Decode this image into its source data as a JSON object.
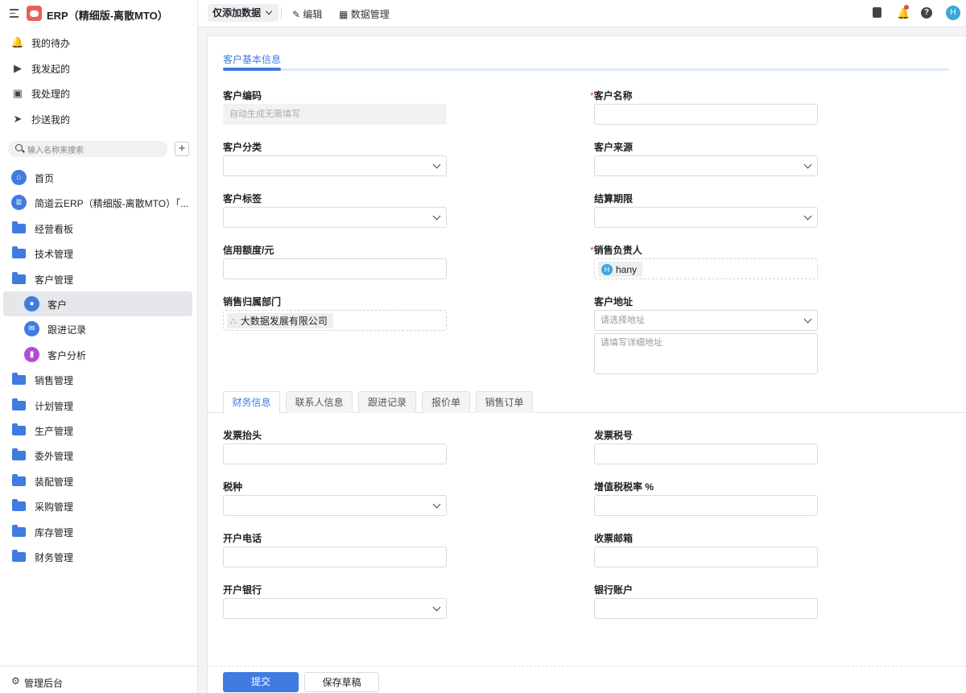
{
  "app": {
    "title": "ERP（精细版-离散MTO）"
  },
  "quick": [
    {
      "label": "我的待办",
      "icon": "bell-icon",
      "glyph": "🔔"
    },
    {
      "label": "我发起的",
      "icon": "play-circle-icon",
      "glyph": "▶"
    },
    {
      "label": "我处理的",
      "icon": "inbox-icon",
      "glyph": "▣"
    },
    {
      "label": "抄送我的",
      "icon": "send-icon",
      "glyph": "➤"
    }
  ],
  "search": {
    "placeholder": "输入名称来搜索",
    "add": "+"
  },
  "nav": [
    {
      "label": "首页",
      "type": "home",
      "glyph": "⌂"
    },
    {
      "label": "简道云ERP（精细版-离散MTO）「...",
      "type": "doc",
      "glyph": "≣"
    },
    {
      "label": "经营看板",
      "type": "folder"
    },
    {
      "label": "技术管理",
      "type": "folder"
    },
    {
      "label": "客户管理",
      "type": "folder"
    },
    {
      "label": "客户",
      "type": "sub",
      "glyph": "●",
      "selected": true
    },
    {
      "label": "跟进记录",
      "type": "sub",
      "glyph": "✉"
    },
    {
      "label": "客户分析",
      "type": "sub",
      "glyph": "▮",
      "color": "#b24dd6"
    },
    {
      "label": "销售管理",
      "type": "folder"
    },
    {
      "label": "计划管理",
      "type": "folder"
    },
    {
      "label": "生产管理",
      "type": "folder"
    },
    {
      "label": "委外管理",
      "type": "folder"
    },
    {
      "label": "装配管理",
      "type": "folder"
    },
    {
      "label": "采购管理",
      "type": "folder"
    },
    {
      "label": "库存管理",
      "type": "folder"
    },
    {
      "label": "财务管理",
      "type": "folder"
    }
  ],
  "admin": {
    "label": "管理后台"
  },
  "topbar": {
    "mode": "仅添加数据",
    "edit": "编辑",
    "data_manage": "数据管理",
    "avatar": "H"
  },
  "form": {
    "section": "客户基本信息",
    "code": {
      "label": "客户编码",
      "placeholder": "自动生成无需填写"
    },
    "name": {
      "label": "客户名称",
      "required": "*"
    },
    "category": {
      "label": "客户分类"
    },
    "source": {
      "label": "客户来源"
    },
    "tag": {
      "label": "客户标签"
    },
    "term": {
      "label": "结算期限"
    },
    "credit": {
      "label": "信用额度/元"
    },
    "owner": {
      "label": "销售负责人",
      "required": "*",
      "value": "hany",
      "initial": "H"
    },
    "dept": {
      "label": "销售归属部门",
      "value": "大数据发展有限公司"
    },
    "address": {
      "label": "客户地址",
      "placeholder": "请选择地址",
      "detail_placeholder": "请填写详细地址"
    }
  },
  "tabs": [
    "财务信息",
    "联系人信息",
    "跟进记录",
    "报价单",
    "销售订单"
  ],
  "finance": {
    "invoice_title": "发票抬头",
    "tax_no": "发票税号",
    "tax_type": "税种",
    "vat_rate": "增值税税率 %",
    "phone": "开户电话",
    "email": "收票邮箱",
    "bank": "开户银行",
    "account": "银行账户"
  },
  "actions": {
    "submit": "提交",
    "draft": "保存草稿"
  },
  "colors": {
    "accent": "#3f7be0",
    "required": "#e5484d"
  }
}
